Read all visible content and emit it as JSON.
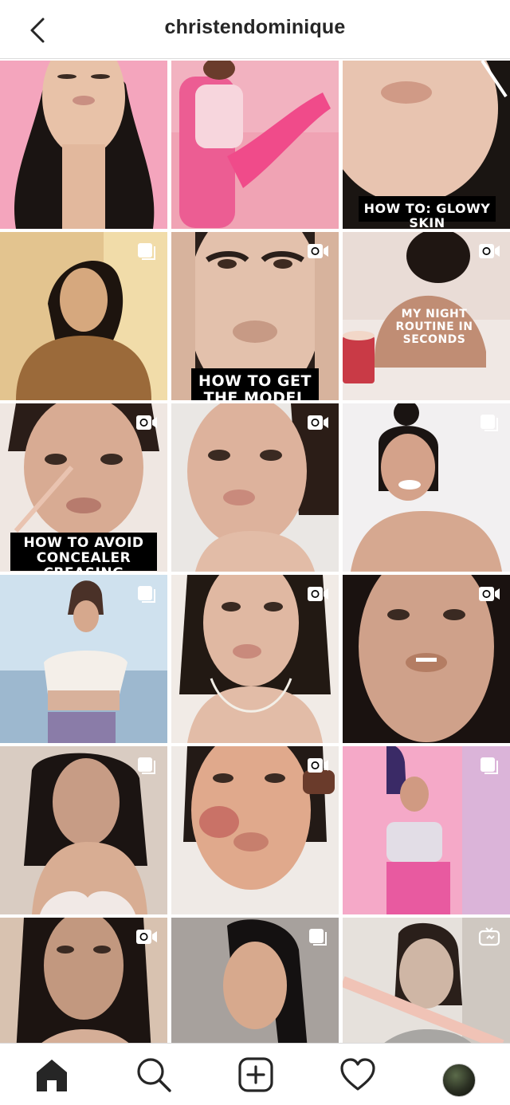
{
  "header": {
    "title": "christendominique",
    "back_icon": "chevron-left-icon"
  },
  "colors": {
    "text": "#262626",
    "border": "#dbdbdb",
    "background": "#ffffff"
  },
  "posts": [
    {
      "badge": "none",
      "overlay": "",
      "colors": [
        "#f5a0b8",
        "#e8c2a8",
        "#1a1412"
      ]
    },
    {
      "badge": "none",
      "overlay": "",
      "colors": [
        "#f0a3b4",
        "#f04b8a",
        "#f7d6dd"
      ]
    },
    {
      "badge": "none",
      "overlay": "HOW TO: GLOWY SKIN",
      "colors": [
        "#e8c4b0",
        "#d09a86",
        "#1a1512"
      ]
    },
    {
      "badge": "carousel",
      "overlay": "",
      "colors": [
        "#e3c48f",
        "#9b6a3a",
        "#1d140e"
      ]
    },
    {
      "badge": "video",
      "overlay": "HOW TO GET THE MODEL BROW",
      "colors": [
        "#e3c1ac",
        "#c79a85",
        "#2a1f1a"
      ]
    },
    {
      "badge": "video",
      "overlay": "MY NIGHT ROUTINE IN SECONDS",
      "colors": [
        "#f0e8e4",
        "#c08d74",
        "#e9dcd6"
      ]
    },
    {
      "badge": "video",
      "overlay": "HOW TO AVOID CONCEALER CREASING",
      "colors": [
        "#efe7e2",
        "#d8ab93",
        "#2a1d18"
      ]
    },
    {
      "badge": "video",
      "overlay": "",
      "colors": [
        "#eae7e4",
        "#ddb29c",
        "#2b1d17"
      ]
    },
    {
      "badge": "carousel",
      "overlay": "",
      "colors": [
        "#f2f0f1",
        "#d4a28a",
        "#1a1412"
      ]
    },
    {
      "badge": "carousel",
      "overlay": "",
      "colors": [
        "#cfe1ee",
        "#9db8cf",
        "#f4efe9"
      ]
    },
    {
      "badge": "video",
      "overlay": "",
      "colors": [
        "#f1ebe6",
        "#e0b8a2",
        "#221913"
      ]
    },
    {
      "badge": "video",
      "overlay": "",
      "colors": [
        "#cfa18a",
        "#b47d63",
        "#1a1210"
      ]
    },
    {
      "badge": "carousel",
      "overlay": "",
      "colors": [
        "#d9ccc2",
        "#c79c85",
        "#1b1412"
      ]
    },
    {
      "badge": "video",
      "overlay": "",
      "colors": [
        "#efeae6",
        "#e0a98c",
        "#b94f4f"
      ]
    },
    {
      "badge": "carousel",
      "overlay": "",
      "colors": [
        "#f5a9c8",
        "#e85aa0",
        "#c9bde4"
      ]
    },
    {
      "badge": "video",
      "overlay": "",
      "colors": [
        "#d8c2b0",
        "#c2987f",
        "#1c1411"
      ]
    },
    {
      "badge": "carousel",
      "overlay": "",
      "colors": [
        "#b7b2ae",
        "#8f8884",
        "#141111"
      ]
    },
    {
      "badge": "igtv",
      "overlay": "",
      "colors": [
        "#e6e1dc",
        "#cfb6a5",
        "#f0c3b6"
      ]
    },
    {
      "badge": "none",
      "overlay": "",
      "colors": [
        "#c9b7a6",
        "#2a201b",
        "#8d7868"
      ]
    },
    {
      "badge": "none",
      "overlay": "",
      "colors": [
        "#cfc6c0",
        "#241c18",
        "#a8978c"
      ]
    },
    {
      "badge": "none",
      "overlay": "",
      "colors": [
        "#e9e3de",
        "#2b211c",
        "#d7c7bc"
      ]
    }
  ],
  "tabbar": {
    "items": [
      {
        "name": "home-icon",
        "active": true
      },
      {
        "name": "search-icon",
        "active": false
      },
      {
        "name": "new-post-icon",
        "active": false
      },
      {
        "name": "activity-heart-icon",
        "active": false
      },
      {
        "name": "profile-avatar",
        "active": false
      }
    ]
  }
}
